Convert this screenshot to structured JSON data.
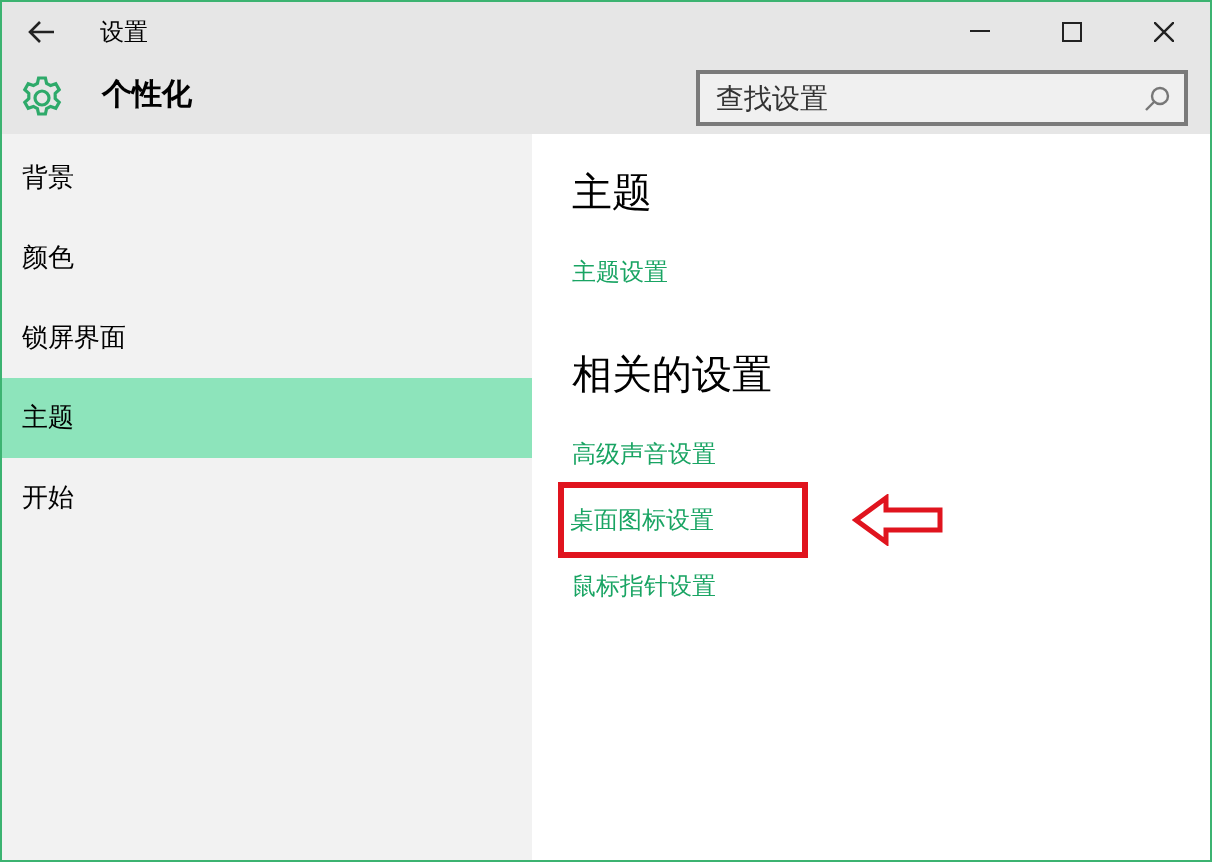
{
  "window": {
    "title": "设置"
  },
  "header": {
    "title": "个性化",
    "search": {
      "placeholder": "查找设置"
    }
  },
  "sidebar": {
    "items": [
      {
        "label": "背景",
        "selected": false
      },
      {
        "label": "颜色",
        "selected": false
      },
      {
        "label": "锁屏界面",
        "selected": false
      },
      {
        "label": "主题",
        "selected": true
      },
      {
        "label": "开始",
        "selected": false
      }
    ]
  },
  "content": {
    "sections": [
      {
        "heading": "主题",
        "links": [
          {
            "label": "主题设置",
            "highlighted": false
          }
        ]
      },
      {
        "heading": "相关的设置",
        "links": [
          {
            "label": "高级声音设置",
            "highlighted": false
          },
          {
            "label": "桌面图标设置",
            "highlighted": true
          },
          {
            "label": "鼠标指针设置",
            "highlighted": false
          }
        ]
      }
    ]
  }
}
